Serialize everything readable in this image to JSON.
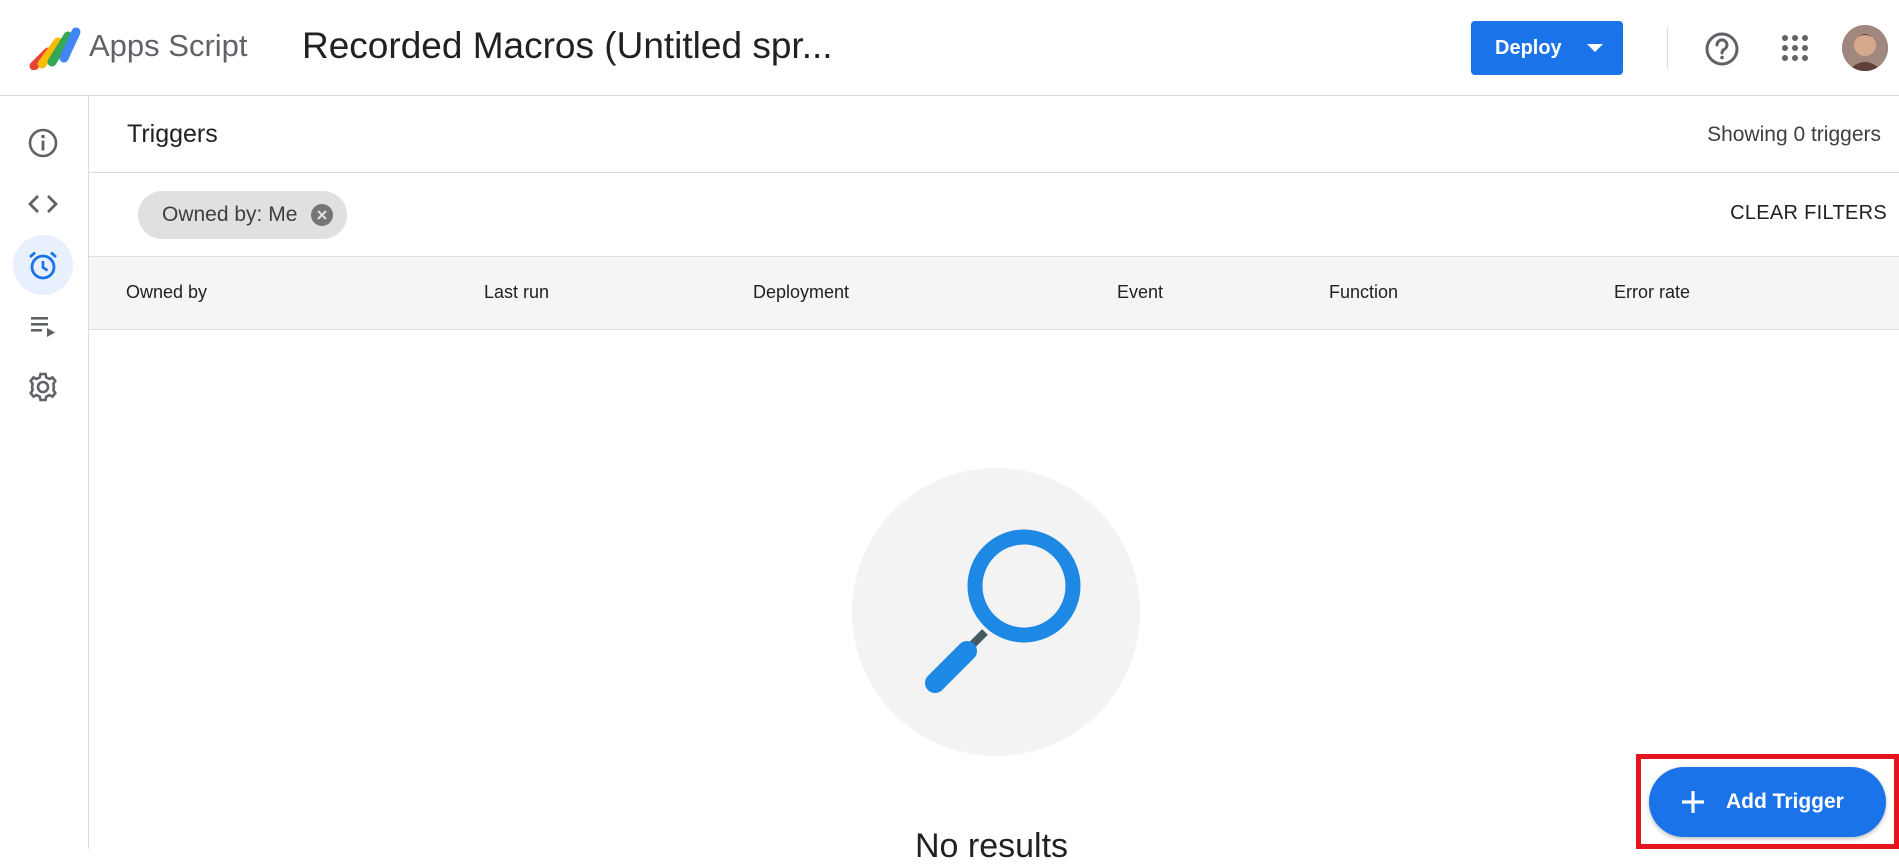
{
  "header": {
    "app_name": "Apps Script",
    "project_title": "Recorded Macros (Untitled spr...",
    "deploy_label": "Deploy",
    "icons": [
      "apps-script-logo",
      "help-icon",
      "apps-grid-icon",
      "avatar"
    ]
  },
  "sidebar": {
    "items": [
      {
        "name": "overview",
        "icon": "info-icon",
        "active": false
      },
      {
        "name": "editor",
        "icon": "code-icon",
        "active": false
      },
      {
        "name": "triggers",
        "icon": "alarm-clock-icon",
        "active": true
      },
      {
        "name": "executions",
        "icon": "executions-list-icon",
        "active": false
      },
      {
        "name": "settings",
        "icon": "gear-icon",
        "active": false
      }
    ]
  },
  "main": {
    "title": "Triggers",
    "showing_count": "Showing 0 triggers",
    "filter_chip": "Owned by: Me",
    "clear_filters": "CLEAR FILTERS",
    "columns": [
      "Owned by",
      "Last run",
      "Deployment",
      "Event",
      "Function",
      "Error rate"
    ],
    "empty_state": "No results",
    "add_trigger_label": "Add Trigger"
  },
  "colors": {
    "accent": "#1a73e8",
    "highlight": "#e4151f",
    "active_nav_bg": "#e8f0fe"
  }
}
